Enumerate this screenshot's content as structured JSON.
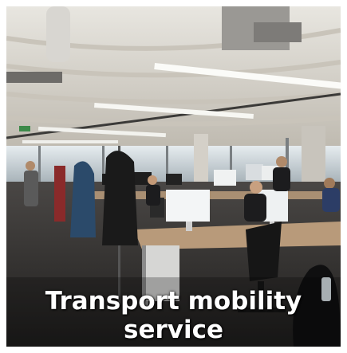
{
  "caption": {
    "line1": "Transport mobility",
    "line2": "service"
  },
  "colors": {
    "ceiling": "#dcd8d0",
    "floor": "#3a3836",
    "desk": "#b89a7a",
    "window": "#cfd8de",
    "caption_text": "#ffffff"
  }
}
